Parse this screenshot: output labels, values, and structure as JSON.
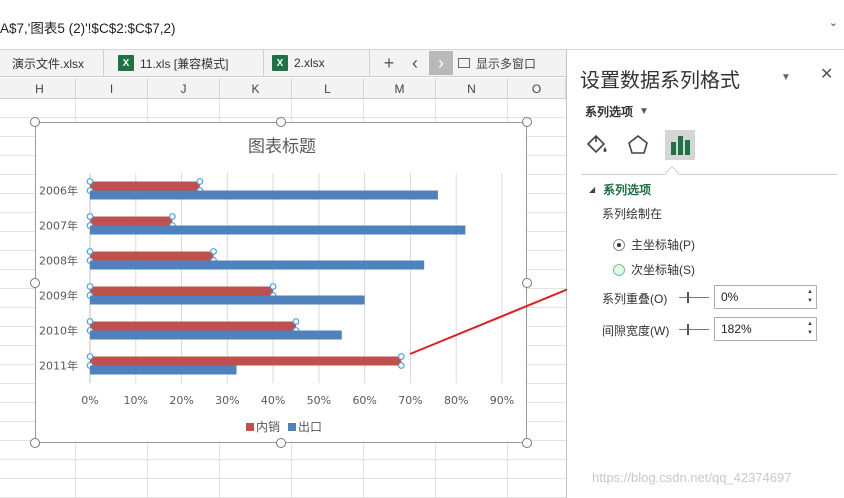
{
  "formula_bar": {
    "formula": "A$7,'图表5 (2)'!$C$2:$C$7,2)",
    "expand_glyph": "⌄"
  },
  "tabs": [
    {
      "label": "演示文件.xlsx",
      "icon": "xls-icon"
    },
    {
      "label": "11.xls  [兼容模式]",
      "icon": "xls-icon"
    },
    {
      "label": "2.xlsx",
      "icon": "xls-icon"
    }
  ],
  "tab_controls": {
    "add": "+",
    "prev": "‹",
    "next": "›",
    "multi_window": "显示多窗口"
  },
  "columns": [
    "H",
    "I",
    "J",
    "K",
    "L",
    "M",
    "N",
    "O"
  ],
  "chart_data": {
    "type": "bar",
    "orientation": "horizontal",
    "title": "图表标题",
    "categories": [
      "2006年",
      "2007年",
      "2008年",
      "2009年",
      "2010年",
      "2011年"
    ],
    "series": [
      {
        "name": "内销",
        "color": "#c0504d",
        "values": [
          0.24,
          0.18,
          0.27,
          0.4,
          0.45,
          0.68
        ]
      },
      {
        "name": "出口",
        "color": "#4f81bd",
        "values": [
          0.76,
          0.82,
          0.73,
          0.6,
          0.55,
          0.32
        ]
      }
    ],
    "x_ticks": [
      "0%",
      "10%",
      "20%",
      "30%",
      "40%",
      "50%",
      "60%",
      "70%",
      "80%",
      "90%"
    ],
    "xlim": [
      0,
      0.9
    ],
    "grid": "vertical",
    "legend": "bottom",
    "selected_series": "内销"
  },
  "format_pane": {
    "title": "设置数据系列格式",
    "close_glyph": "✕",
    "menu_label": "系列选项",
    "section_title": "系列选项",
    "plot_on_label": "系列绘制在",
    "primary_axis": "主坐标轴(P)",
    "secondary_axis": "次坐标轴(S)",
    "overlap_label": "系列重叠(O)",
    "overlap_value": "0%",
    "gap_label": "间隙宽度(W)",
    "gap_value": "182%",
    "icons": [
      "paint-bucket-icon",
      "pentagon-icon",
      "bar-chart-icon"
    ]
  },
  "watermark": "https://blog.csdn.net/qq_42374697",
  "annotation_color": "#e02020"
}
